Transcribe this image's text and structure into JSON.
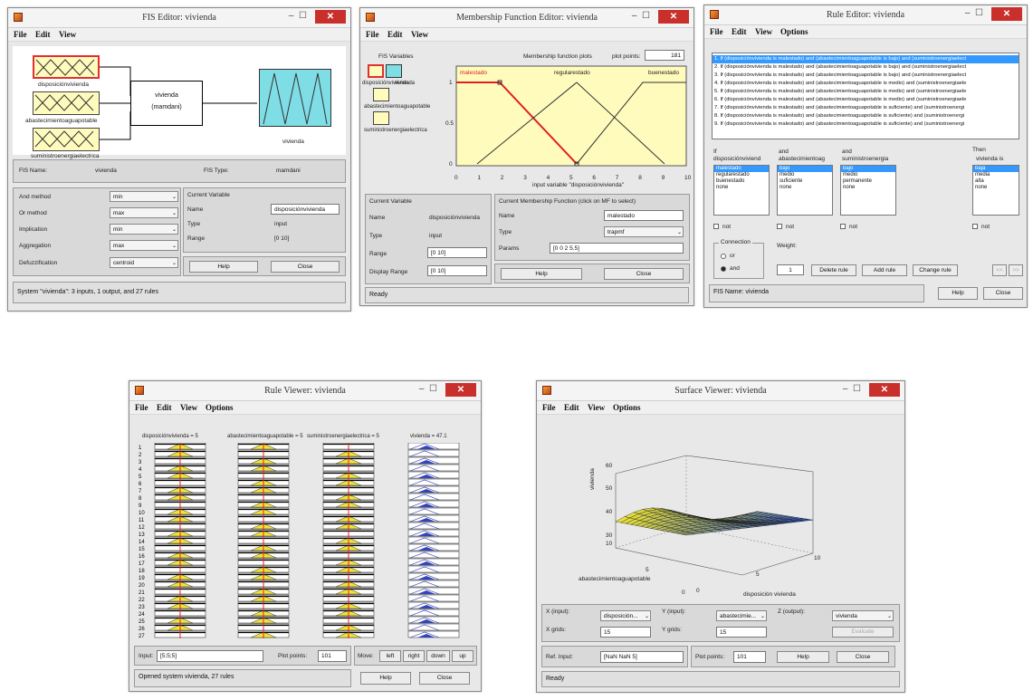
{
  "fis": {
    "title": "FIS Editor: vivienda",
    "menu": [
      "File",
      "Edit",
      "View"
    ],
    "inputs": [
      "disposiciónvivienda",
      "abastecimientoaguapotable",
      "suministroenergiaelectrica"
    ],
    "sys_name": "vivienda",
    "sys_type": "(mamdani)",
    "output": "vivienda",
    "fis_name_lbl": "FIS Name:",
    "fis_name": "vivienda",
    "fis_type_lbl": "FIS Type:",
    "fis_type": "mamdani",
    "and_lbl": "And method",
    "and_val": "min",
    "or_lbl": "Or method",
    "or_val": "max",
    "imp_lbl": "Implication",
    "imp_val": "min",
    "agg_lbl": "Aggregation",
    "agg_val": "max",
    "def_lbl": "Defuzzification",
    "def_val": "centroid",
    "cv_title": "Current Variable",
    "name_lbl": "Name",
    "name_val": "disposiciónvivienda",
    "type_lbl": "Type",
    "type_val": "input",
    "range_lbl": "Range",
    "range_val": "[0 10]",
    "help": "Help",
    "close": "Close",
    "status": "System \"vivienda\": 3 inputs, 1 output, and 27 rules"
  },
  "mf": {
    "title": "Membership Function Editor: vivienda",
    "menu": [
      "File",
      "Edit",
      "View"
    ],
    "vars_lbl": "FIS Variables",
    "vars": [
      "disposiciónvivienda",
      "vivienda",
      "abastecimientoaguapotable",
      "suministroenergiaelectrica"
    ],
    "plots_lbl": "Membership function plots",
    "points_lbl": "plot points:",
    "points": "181",
    "mf_names": [
      "malestado",
      "regularestado",
      "buenestado"
    ],
    "xaxis_lbl": "input variable \"disposiciónvivienda\"",
    "xticks": [
      "0",
      "1",
      "2",
      "3",
      "4",
      "5",
      "6",
      "7",
      "8",
      "9",
      "10"
    ],
    "yticks": [
      "1",
      "0.5",
      "0"
    ],
    "cv_title": "Current Variable",
    "name_lbl": "Name",
    "name_val": "disposiciónvivienda",
    "type_lbl": "Type",
    "type_val": "input",
    "range_lbl": "Range",
    "range_val": "[0 10]",
    "dr_lbl": "Display Range",
    "dr_val": "[0 10]",
    "cmf_title": "Current Membership Function (click on MF to select)",
    "mname_lbl": "Name",
    "mname_val": "malestado",
    "mtype_lbl": "Type",
    "mtype_val": "trapmf",
    "params_lbl": "Params",
    "params_val": "[0 0 2 5.5]",
    "help": "Help",
    "close": "Close",
    "status": "Ready"
  },
  "rule": {
    "title": "Rule Editor: vivienda",
    "menu": [
      "File",
      "Edit",
      "View",
      "Options"
    ],
    "rules": [
      "1. If (disposiciónvivienda is malestado) and (abastecimientoaguapotable is bajo) and (suministroenergiaelect",
      "2. If (disposiciónvivienda is malestado) and (abastecimientoaguapotable is bajo) and (suministroenergiaelect",
      "3. If (disposiciónvivienda is malestado) and (abastecimientoaguapotable is bajo) and (suministroenergiaelect",
      "4. If (disposiciónvivienda is malestado) and (abastecimientoaguapotable is medio) and (suministroenergiaele",
      "5. If (disposiciónvivienda is malestado) and (abastecimientoaguapotable is medio) and (suministroenergiaele",
      "6. If (disposiciónvivienda is malestado) and (abastecimientoaguapotable is medio) and (suministroenergiaele",
      "7. If (disposiciónvivienda is malestado) and (abastecimientoaguapotable is suficiente) and (suministroenergi",
      "8. If (disposiciónvivienda is malestado) and (abastecimientoaguapotable is suficiente) and (suministroenergi",
      "9. If (disposiciónvivienda is malestado) and (abastecimientoaguapotable is suficiente) and (suministroenergi"
    ],
    "if": "If",
    "and1": "and",
    "and2": "and",
    "then": "Then",
    "h1": "disposiciónviviend",
    "h2": "abastecimientoag",
    "h3": "suministroenergia",
    "h4": "vivienda is",
    "l1": [
      "malestado",
      "regularestado",
      "buenestado",
      "none"
    ],
    "l2": [
      "bajo",
      "medio",
      "suficiente",
      "none"
    ],
    "l3": [
      "bajo",
      "medio",
      "permanente",
      "none"
    ],
    "l4": [
      "baja",
      "media",
      "alta",
      "none"
    ],
    "not": "not",
    "conn_lbl": "Connection",
    "or": "or",
    "and": "and",
    "weight_lbl": "Weight:",
    "weight": "1",
    "del": "Delete rule",
    "add": "Add rule",
    "chg": "Change rule",
    "prev": "<<",
    "next": ">>",
    "fisname": "FIS Name: vivienda",
    "help": "Help",
    "close": "Close"
  },
  "rv": {
    "title": "Rule Viewer: vivienda",
    "menu": [
      "File",
      "Edit",
      "View",
      "Options"
    ],
    "h1": "disposiciónvivienda = 5",
    "h2": "abastecimientoaguapotable = 5",
    "h3": "suministroenergiaelectrica = 5",
    "h4": "vivienda = 47.1",
    "input_lbl": "Input:",
    "input_val": "[5;5;5]",
    "pp_lbl": "Plot points:",
    "pp_val": "101",
    "move_lbl": "Move:",
    "left": "left",
    "right": "right",
    "down": "down",
    "up": "up",
    "status": "Opened system vivienda, 27 rules",
    "help": "Help",
    "close": "Close"
  },
  "sv": {
    "title": "Surface Viewer: vivienda",
    "menu": [
      "File",
      "Edit",
      "View",
      "Options"
    ],
    "zlabel": "vivienda",
    "xlabel": "disposición vivienda",
    "ylabel": "abastecimientoaguapotable",
    "zticks": [
      "60",
      "50",
      "40",
      "30"
    ],
    "xticks": [
      "0",
      "5",
      "10"
    ],
    "yticks": [
      "10",
      "5",
      "0"
    ],
    "x_lbl": "X (input):",
    "x_val": "disposición...",
    "y_lbl": "Y (input):",
    "y_val": "abastecimie...",
    "z_lbl": "Z (output):",
    "z_val": "vivienda",
    "xg_lbl": "X grids:",
    "xg_val": "15",
    "yg_lbl": "Y grids:",
    "yg_val": "15",
    "eval": "Evaluate",
    "ref_lbl": "Ref. Input:",
    "ref_val": "[NaN NaN 5]",
    "pp_lbl": "Plot points:",
    "pp_val": "101",
    "help": "Help",
    "close": "Close",
    "status": "Ready"
  }
}
